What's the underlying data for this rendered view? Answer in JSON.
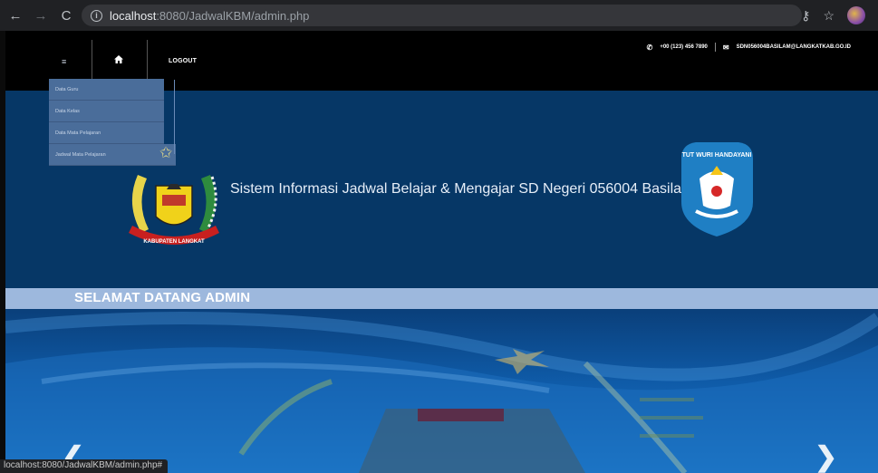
{
  "browser": {
    "url_host": "localhost",
    "url_path": ":8080/JadwalKBM/admin.php",
    "nav": {
      "back_icon": "arrow-left-icon",
      "forward_icon": "arrow-right-icon",
      "reload_icon": "reload-icon"
    },
    "status_url": "localhost:8080/JadwalKBM/admin.php#"
  },
  "header": {
    "menu_icon": "≡",
    "home_icon": "🏠",
    "logout_label": "LOGOUT",
    "phone": "+00 (123) 456 7890",
    "email": "SDN056004BASILAM@LANGKATKAB.GO.ID"
  },
  "dropdown": {
    "items": [
      {
        "label": "Data Guru"
      },
      {
        "label": "Data Kelas"
      },
      {
        "label": "Data Mata Pelajaran"
      },
      {
        "label": "Jadwal Mata Pelajaran"
      }
    ]
  },
  "banner": {
    "title": "Sistem Informasi Jadwal Belajar & Mengajar SD Negeri 056004 Basilam",
    "left_logo_ribbon": "KABUPATEN LANGKAT",
    "right_logo_text": "TUT WURI HANDAYANI"
  },
  "welcome": {
    "text": "SELAMAT DATANG ADMIN"
  },
  "slider": {
    "prev_icon": "chevron-left-icon",
    "next_icon": "chevron-right-icon"
  },
  "colors": {
    "banner": "#063766",
    "welcome_strip": "#9db8dd",
    "dropdown": "#4a6d9a"
  }
}
